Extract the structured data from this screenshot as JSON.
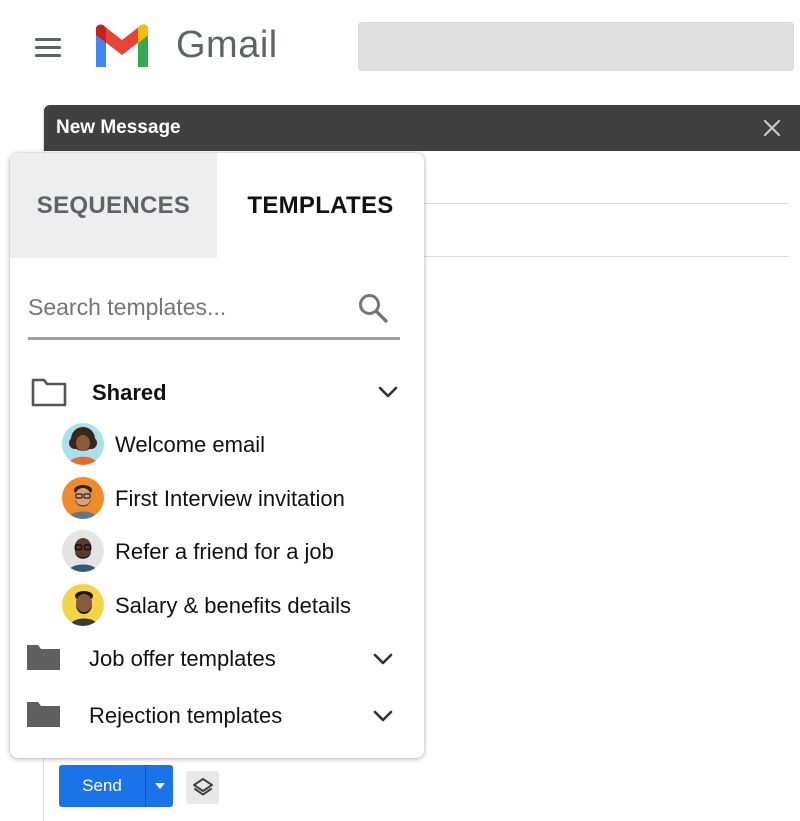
{
  "app": {
    "wordmark": "Gmail"
  },
  "compose": {
    "title": "New Message",
    "send_label": "Send"
  },
  "panel": {
    "tabs": [
      {
        "label": "SEQUENCES",
        "active": false
      },
      {
        "label": "TEMPLATES",
        "active": true
      }
    ],
    "search": {
      "placeholder": "Search templates...",
      "value": ""
    },
    "folders": [
      {
        "label": "Shared",
        "expanded": true,
        "icon": "folder-outline-icon",
        "items": [
          {
            "label": "Welcome email",
            "avatar": "avatar-woman-curly"
          },
          {
            "label": "First Interview invitation",
            "avatar": "avatar-man-glasses-beard"
          },
          {
            "label": "Refer a friend for a job",
            "avatar": "avatar-man-glasses-bald"
          },
          {
            "label": "Salary & benefits details",
            "avatar": "avatar-man-beard-yellow"
          }
        ]
      },
      {
        "label": "Job offer templates",
        "expanded": false,
        "icon": "folder-filled-icon"
      },
      {
        "label": "Rejection templates",
        "expanded": false,
        "icon": "folder-filled-icon"
      }
    ]
  },
  "colors": {
    "send_blue": "#1a73e8",
    "compose_header": "#404040",
    "inactive_tab": "#eeeeee",
    "gmail_red": "#ea4335",
    "gmail_blue": "#4285f4",
    "gmail_green": "#34a853",
    "gmail_yellow": "#fbbc04"
  }
}
